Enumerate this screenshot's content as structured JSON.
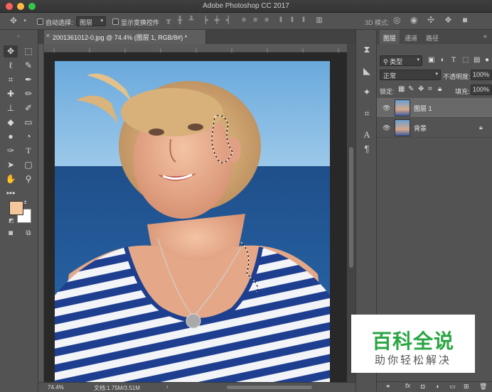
{
  "window": {
    "title": "Adobe Photoshop CC 2017"
  },
  "options_bar": {
    "auto_select_label": "自动选择:",
    "auto_select_value": "图层",
    "show_transform_label": "显示变换控件",
    "mode_3d_label": "3D 模式:"
  },
  "document": {
    "tab_title": "2001361012-0.jpg @ 74.4% (图层 1, RGB/8#) *",
    "zoom": "74.4%",
    "doc_info": "文档:1.75M/3.51M"
  },
  "colors": {
    "foreground": "#f5c59b",
    "background": "#ffffff"
  },
  "panel": {
    "tabs": [
      "图层",
      "通道",
      "路径"
    ],
    "filter_kind": "类型",
    "blend_mode": "正常",
    "opacity_label": "不透明度:",
    "opacity_value": "100%",
    "lock_label": "锁定:",
    "fill_label": "填充:",
    "fill_value": "100%",
    "layers": [
      {
        "name": "图层 1",
        "selected": true,
        "locked": false
      },
      {
        "name": "背景",
        "selected": false,
        "locked": true
      }
    ]
  },
  "watermark": {
    "line1": "百科全说",
    "line2": "助你轻松解决"
  }
}
